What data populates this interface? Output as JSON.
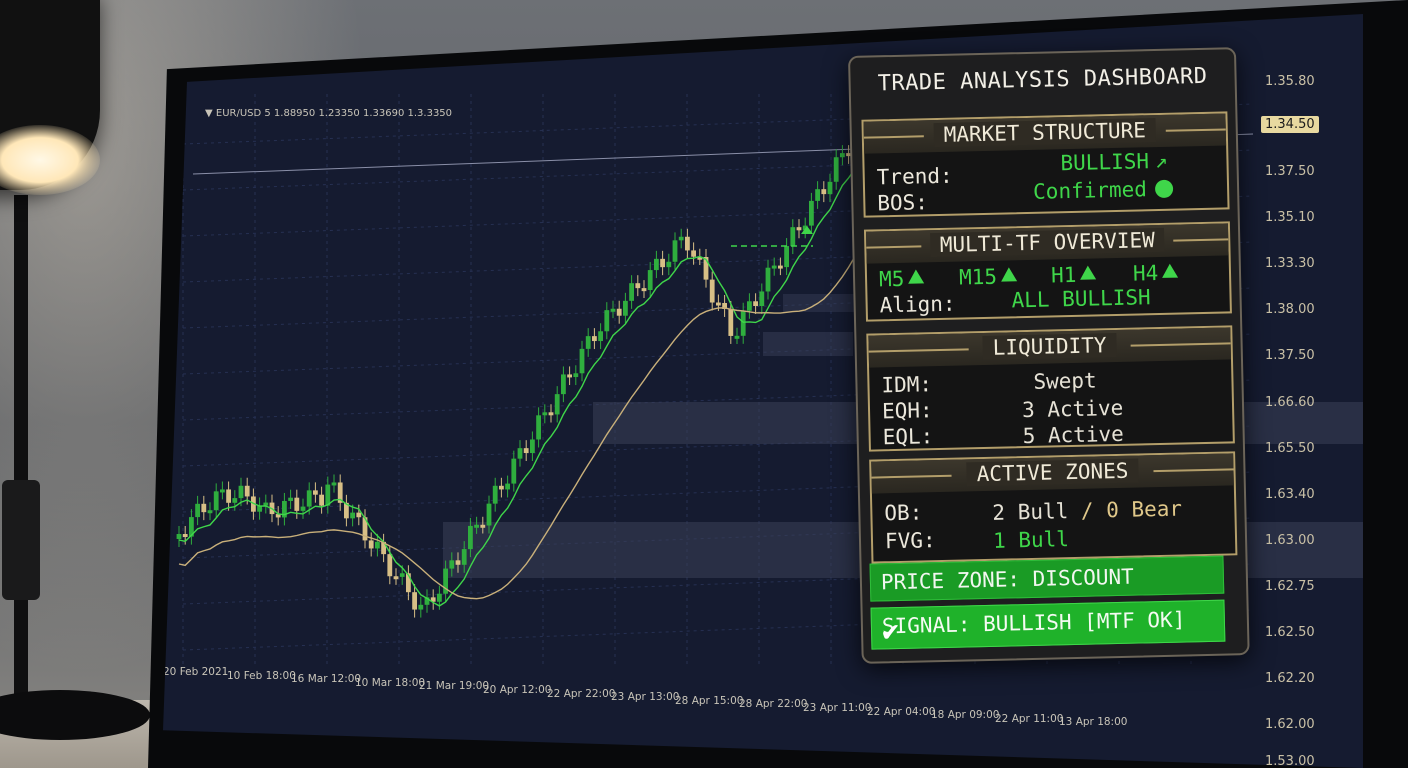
{
  "chart": {
    "symbol_line": "▼ EUR/USD 5  1.88950  1.23350  1.33690  1.3.3350",
    "price_ticks": [
      "1.35.80",
      "1.34.50",
      "1.37.50",
      "1.35.10",
      "1.33.30",
      "1.38.00",
      "1.37.50",
      "1.66.60",
      "1.65.50",
      "1.63.40",
      "1.63.00",
      "1.62.75",
      "1.62.50",
      "1.62.20",
      "1.62.00",
      "1.53.00"
    ],
    "highlighted_price": "1.34.50",
    "time_ticks": [
      "20 Feb 2021",
      "10 Feb 18:00",
      "16 Mar 12:00",
      "10 Mar 18:00",
      "21 Mar 19:00",
      "20 Apr 12:00",
      "22 Apr 22:00",
      "23 Apr 13:00",
      "28 Apr 15:00",
      "28 Apr 22:00",
      "23 Apr 11:00",
      "22 Apr 04:00",
      "18 Apr 09:00",
      "22 Apr 11:00",
      "13 Apr 18:00"
    ]
  },
  "dashboard": {
    "title": "TRADE ANALYSIS DASHBOARD",
    "market_structure": {
      "header": "MARKET STRUCTURE",
      "trend_label": "Trend:",
      "trend_value": "BULLISH",
      "bos_label": "BOS:",
      "bos_value": "Confirmed"
    },
    "multi_tf": {
      "header": "MULTI-TF OVERVIEW",
      "timeframes": [
        "M5",
        "M15",
        "H1",
        "H4"
      ],
      "align_label": "Align:",
      "align_value": "ALL BULLISH"
    },
    "liquidity": {
      "header": "LIQUIDITY",
      "idm_label": "IDM:",
      "idm_value": "Swept",
      "eqh_label": "EQH:",
      "eqh_value": "3 Active",
      "eql_label": "EQL:",
      "eql_value": "5 Active"
    },
    "active_zones": {
      "header": "ACTIVE ZONES",
      "ob_label": "OB:",
      "ob_bull": "2 Bull",
      "ob_sep": "/",
      "ob_bear": "0 Bear",
      "fvg_label": "FVG:",
      "fvg_value": "1 Bull"
    },
    "price_zone": "PRICE ZONE: DISCOUNT",
    "signal": "SIGNAL: BULLISH [MTF OK]"
  },
  "colors": {
    "bullish_green": "#3fd64a",
    "bear_tan": "#e0c88a",
    "gold_border": "#b39e6a",
    "chart_bg": "#151b30"
  }
}
